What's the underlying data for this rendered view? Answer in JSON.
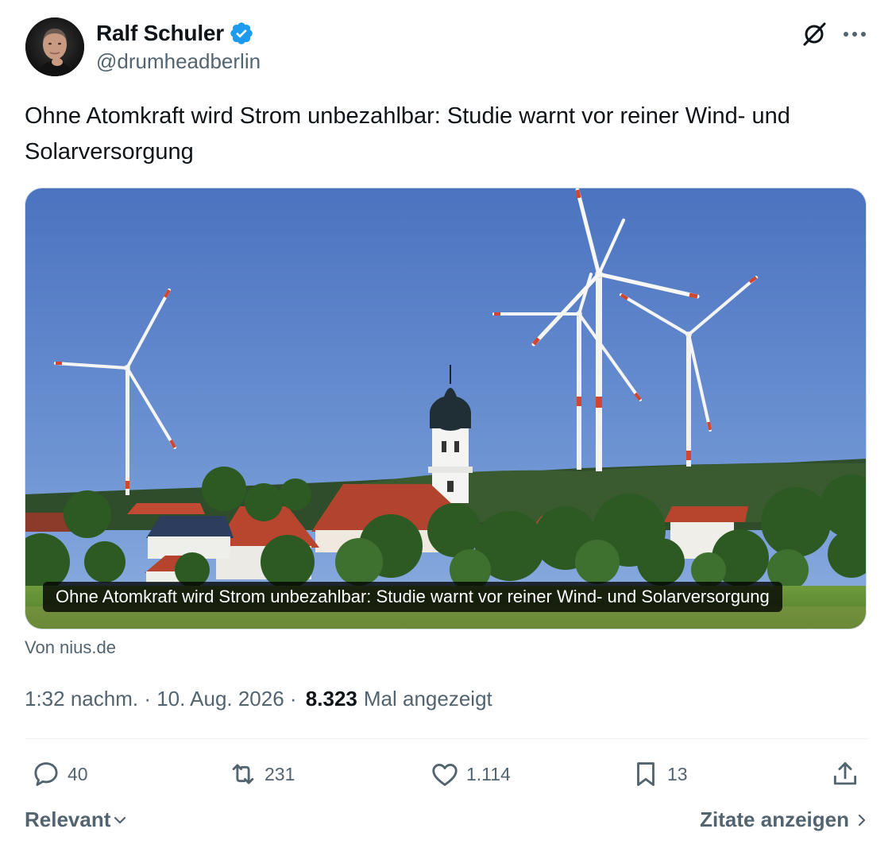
{
  "author": {
    "name": "Ralf Schuler",
    "handle": "@drumheadberlin",
    "verified": true,
    "verified_color": "#1d9bf0"
  },
  "tweet": {
    "text": "Ohne Atomkraft wird Strom unbezahlbar: Studie warnt vor reiner Wind- und Solarversorgung"
  },
  "card": {
    "caption": "Ohne Atomkraft wird Strom unbezahlbar: Studie warnt vor reiner Wind- und Solarversorgung",
    "source": "Von nius.de",
    "image_subject": "wind-turbines-behind-village-church"
  },
  "meta": {
    "time": "1:32 nachm.",
    "separator": " · ",
    "date": "10. Aug. 2026",
    "views_count": "8.323",
    "views_label": "Mal angezeigt"
  },
  "actions": {
    "replies": "40",
    "reposts": "231",
    "likes": "1.114",
    "bookmarks": "13"
  },
  "footer": {
    "sort_label": "Relevant",
    "quotes_label": "Zitate anzeigen"
  },
  "colors": {
    "text_primary": "#0f1419",
    "text_secondary": "#536471",
    "divider": "#eff3f4"
  }
}
